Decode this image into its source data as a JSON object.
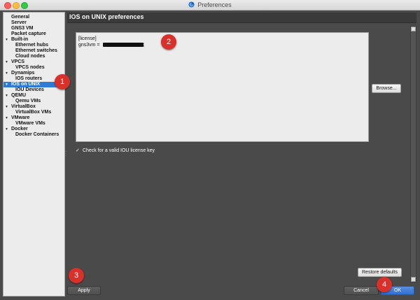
{
  "window": {
    "title": "Preferences",
    "app_icon": "gns3-icon"
  },
  "sidebar": {
    "items": [
      {
        "label": "General",
        "level": 0,
        "expandable": false
      },
      {
        "label": "Server",
        "level": 0,
        "expandable": false
      },
      {
        "label": "GNS3 VM",
        "level": 0,
        "expandable": false
      },
      {
        "label": "Packet capture",
        "level": 0,
        "expandable": false
      },
      {
        "label": "Built-in",
        "level": 0,
        "expandable": true
      },
      {
        "label": "Ethernet hubs",
        "level": 1,
        "expandable": false
      },
      {
        "label": "Ethernet switches",
        "level": 1,
        "expandable": false
      },
      {
        "label": "Cloud nodes",
        "level": 1,
        "expandable": false
      },
      {
        "label": "VPCS",
        "level": 0,
        "expandable": true
      },
      {
        "label": "VPCS nodes",
        "level": 1,
        "expandable": false
      },
      {
        "label": "Dynamips",
        "level": 0,
        "expandable": true
      },
      {
        "label": "IOS routers",
        "level": 1,
        "expandable": false
      },
      {
        "label": "IOS on UNIX",
        "level": 0,
        "expandable": true,
        "selected": true
      },
      {
        "label": "IOU Devices",
        "level": 1,
        "expandable": false
      },
      {
        "label": "QEMU",
        "level": 0,
        "expandable": true
      },
      {
        "label": "Qemu VMs",
        "level": 1,
        "expandable": false
      },
      {
        "label": "VirtualBox",
        "level": 0,
        "expandable": true
      },
      {
        "label": "VirtualBox VMs",
        "level": 1,
        "expandable": false
      },
      {
        "label": "VMware",
        "level": 0,
        "expandable": true
      },
      {
        "label": "VMware VMs",
        "level": 1,
        "expandable": false
      },
      {
        "label": "Docker",
        "level": 0,
        "expandable": true
      },
      {
        "label": "Docker Containers",
        "level": 1,
        "expandable": false
      }
    ]
  },
  "content": {
    "section_title": "IOS on UNIX preferences",
    "license_lines": [
      "[license]",
      "gns3vm = "
    ],
    "license_suffix": ";",
    "browse_label": "Browse...",
    "check_license_label": "Check for a valid IOU license key",
    "check_license_checked": true,
    "restore_defaults_label": "Restore defaults"
  },
  "footer": {
    "apply_label": "Apply",
    "cancel_label": "Cancel",
    "ok_label": "OK"
  },
  "callouts": [
    "1",
    "2",
    "3",
    "4"
  ],
  "colors": {
    "callout": "#d9302a",
    "selection": "#2e7bd6"
  }
}
